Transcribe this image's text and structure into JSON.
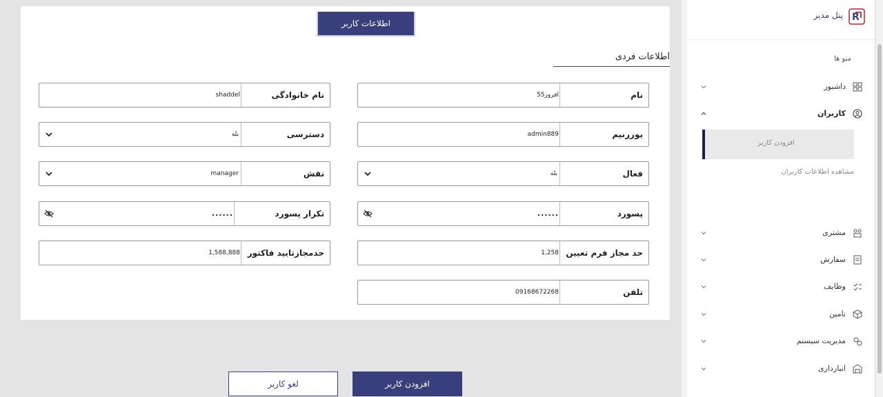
{
  "tab": {
    "label": "اطلاعات کاربر"
  },
  "section": {
    "title": "اطلاعات فردی"
  },
  "fields": {
    "first_name": {
      "label": "نام",
      "value": "افروز55"
    },
    "last_name": {
      "label": "نام خانوادگی",
      "value": "shaddel"
    },
    "username": {
      "label": "یوزرنیم",
      "value": "admin889"
    },
    "access": {
      "label": "دسترسی",
      "value": "بله"
    },
    "active": {
      "label": "فعال",
      "value": "بله"
    },
    "role": {
      "label": "نقش",
      "value": "manager"
    },
    "password": {
      "label": "پسورد",
      "value": "......"
    },
    "password_confirm": {
      "label": "تکرار پسورد",
      "value": "......"
    },
    "form_limit": {
      "label": "حد مجاز فرم تعیین",
      "value": "1,258"
    },
    "invoice_limit": {
      "label": "حدمجازتایید فاکتور",
      "value": "1,588,888"
    },
    "phone": {
      "label": "تلفن",
      "value": "09168672268"
    }
  },
  "buttons": {
    "add": "افزودن کاربر",
    "cancel": "لغو کاربر"
  },
  "sidebar": {
    "title": "پنل مدیر",
    "menus_label": "منو ها",
    "items": [
      {
        "label": "داشبور",
        "icon": "grid-icon"
      },
      {
        "label": "کاربران",
        "icon": "user-circle-icon"
      },
      {
        "label": "مشتری",
        "icon": "people-icon"
      },
      {
        "label": "سفارش",
        "icon": "order-icon"
      },
      {
        "label": "وظایف",
        "icon": "tasks-icon"
      },
      {
        "label": "تامین",
        "icon": "supply-icon"
      },
      {
        "label": "مدیریت سیستم",
        "icon": "system-icon"
      },
      {
        "label": "انبارداری",
        "icon": "warehouse-icon"
      }
    ],
    "sub_items": [
      "افزودن کاربر",
      "مشاهده اطلاعات کاربران"
    ]
  },
  "colors": {
    "primary": "#383f7c",
    "background": "#e4e4e4"
  }
}
